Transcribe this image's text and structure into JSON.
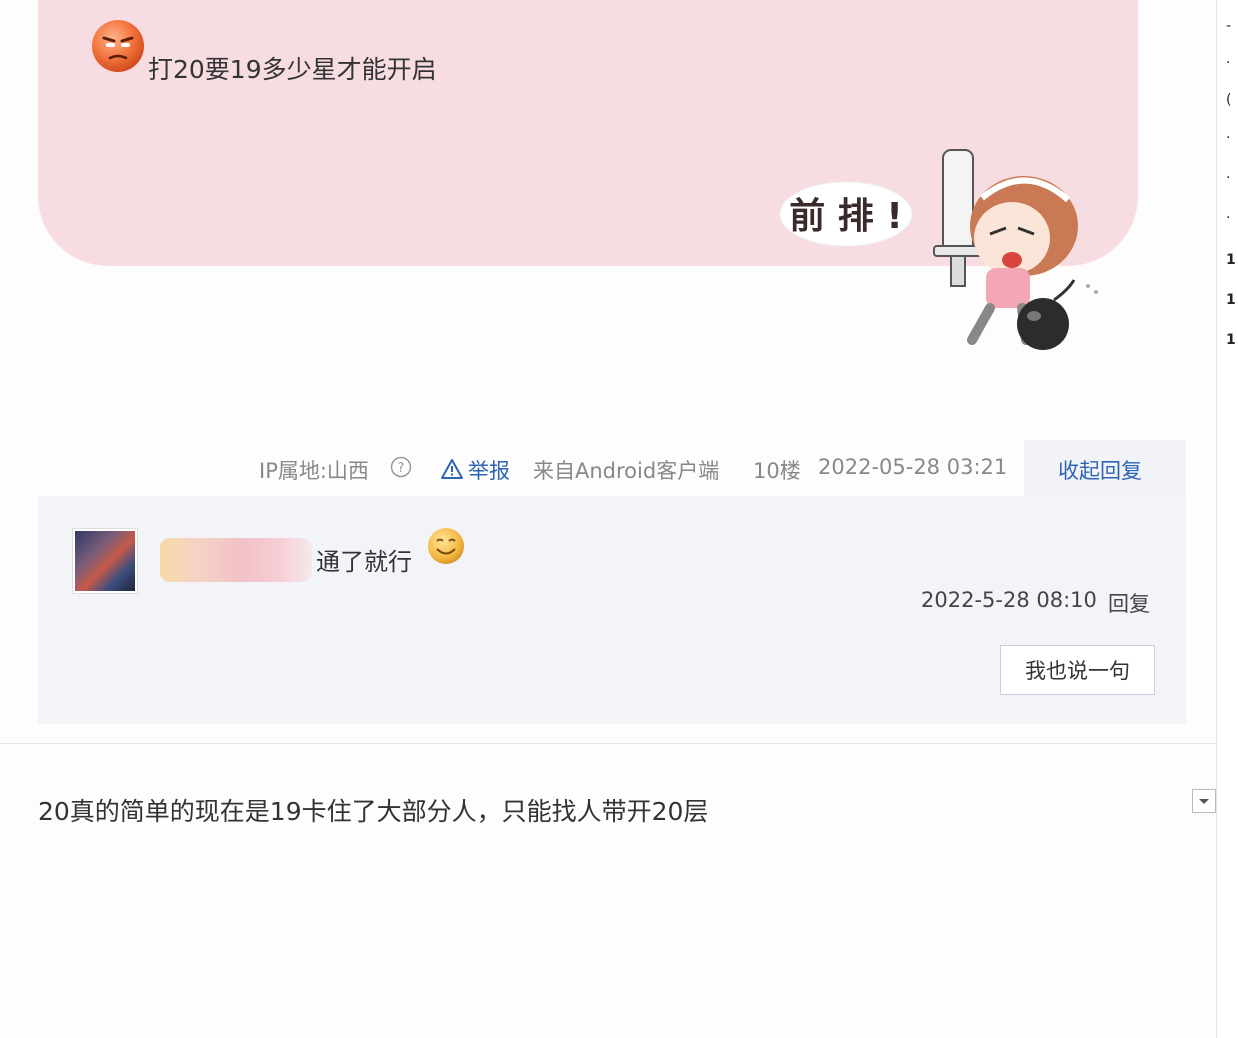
{
  "post": {
    "quote_text": "打20要19多少星才能开启",
    "sticker_text": "前 排 !",
    "meta": {
      "ip_location": "IP属地:山西",
      "report": "举报",
      "client": "来自Android客户端",
      "floor": "10楼",
      "datetime": "2022-05-28 03:21"
    },
    "collapse_replies": "收起回复"
  },
  "sub_reply": {
    "text": "通了就行",
    "time": "2022-5-28 08:10",
    "reply_label": "回复",
    "say_button": "我也说一句"
  },
  "next_post": {
    "text": "20真的简单的现在是19卡住了大部分人，只能找人带开20层"
  },
  "right_edge_chars": [
    "-",
    "·",
    "(",
    "·",
    "·",
    "·",
    "1",
    "1",
    "1"
  ],
  "colors": {
    "bubble_pink": "#f7dde2",
    "link_blue": "#2d64b3",
    "panel_bg": "#f2f4f8"
  },
  "icons": {
    "emoji_1": "angry-face-emoji",
    "emoji_2": "smile-emoji",
    "help": "question-circle-icon",
    "warn": "warning-triangle-icon",
    "dropdown": "chevron-down-icon"
  }
}
